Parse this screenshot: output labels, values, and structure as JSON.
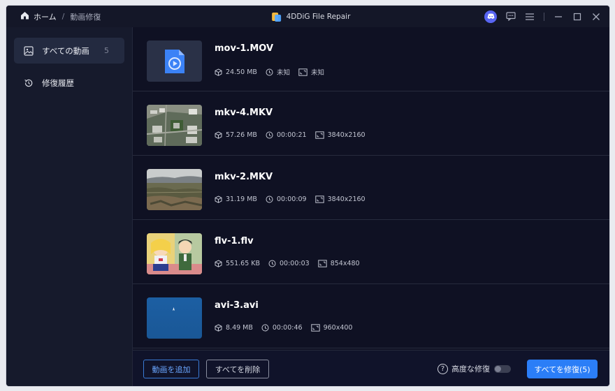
{
  "titlebar": {
    "home_label": "ホーム",
    "separator": "/",
    "current_page": "動画修復",
    "app_name": "4DDiG File Repair"
  },
  "sidebar": {
    "items": [
      {
        "label": "すべての動画",
        "count": "5",
        "icon": "image-icon"
      },
      {
        "label": "修復履歴",
        "icon": "history-icon"
      }
    ]
  },
  "files": [
    {
      "name": "mov-1.MOV",
      "size": "24.50 MB",
      "duration": "未知",
      "resolution": "未知",
      "thumb": "video-file-icon"
    },
    {
      "name": "mkv-4.MKV",
      "size": "57.26 MB",
      "duration": "00:00:21",
      "resolution": "3840x2160",
      "thumb": "aerial-city"
    },
    {
      "name": "mkv-2.MKV",
      "size": "31.19 MB",
      "duration": "00:00:09",
      "resolution": "3840x2160",
      "thumb": "forest-landscape"
    },
    {
      "name": "flv-1.flv",
      "size": "551.65 KB",
      "duration": "00:00:03",
      "resolution": "854x480",
      "thumb": "anime-characters"
    },
    {
      "name": "avi-3.avi",
      "size": "8.49 MB",
      "duration": "00:00:46",
      "resolution": "960x400",
      "thumb": "blue-sky"
    }
  ],
  "footer": {
    "add_video": "動画を追加",
    "delete_all": "すべてを削除",
    "advanced_repair": "高度な修復",
    "advanced_repair_enabled": false,
    "repair_all": "すべてを修復(5)"
  },
  "colors": {
    "accent": "#2b7ef7",
    "background": "#0f1123",
    "sidebar": "#161a2c"
  }
}
